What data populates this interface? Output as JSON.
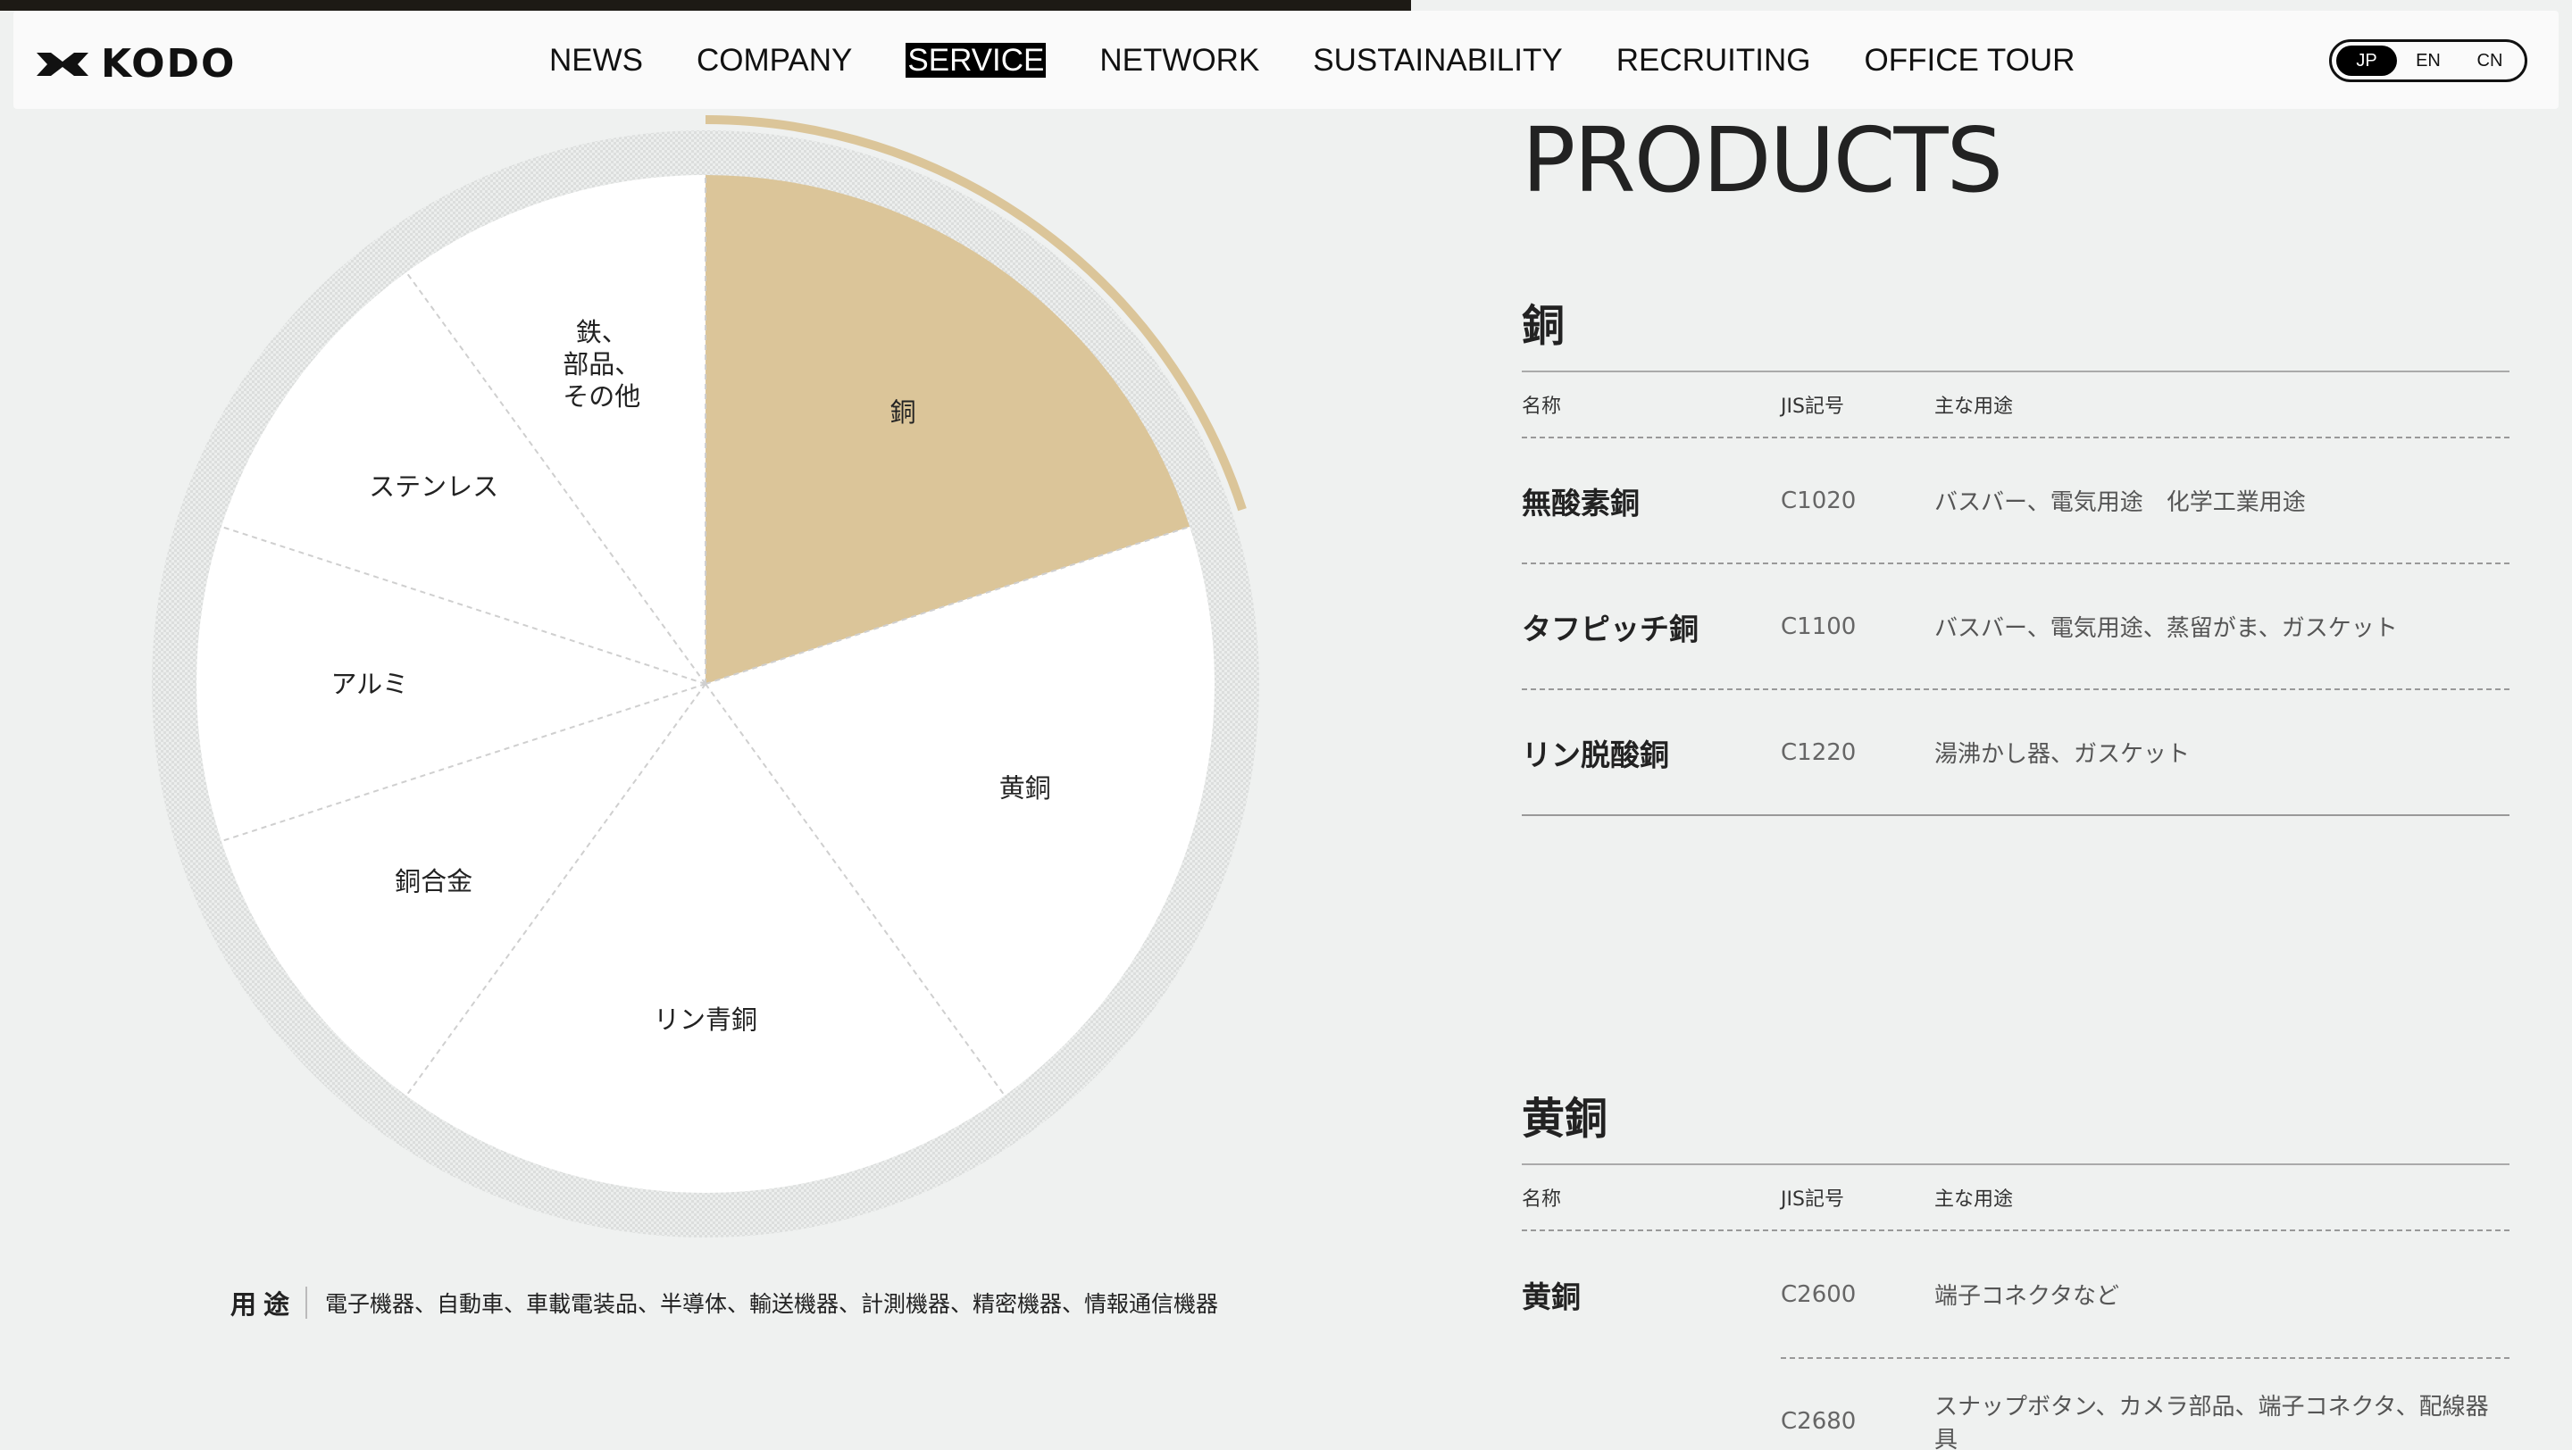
{
  "header": {
    "logo_text": "KODO",
    "nav": [
      "NEWS",
      "COMPANY",
      "SERVICE",
      "NETWORK",
      "SUSTAINABILITY",
      "RECRUITING",
      "OFFICE TOUR"
    ],
    "active_nav": "SERVICE",
    "languages": [
      "JP",
      "EN",
      "CN"
    ],
    "active_language": "JP"
  },
  "chart_data": {
    "type": "pie",
    "slices": [
      {
        "label": "銅",
        "value": 20,
        "highlighted": true
      },
      {
        "label": "黄銅",
        "value": 20
      },
      {
        "label": "リン青銅",
        "value": 20
      },
      {
        "label": "銅合金",
        "value": 10
      },
      {
        "label": "アルミ",
        "value": 10
      },
      {
        "label": "ステンレス",
        "value": 10
      },
      {
        "label": "鉄、\n部品、\nその他",
        "value": 10
      }
    ],
    "highlight_color": "#dbc599",
    "slice_color": "#ffffff"
  },
  "usage": {
    "label": "用途",
    "text": "電子機器、自動車、車載電装品、半導体、輸送機器、計測機器、精密機器、情報通信機器"
  },
  "products": {
    "title": "PRODUCTS",
    "categories": [
      {
        "name": "銅",
        "headers": [
          "名称",
          "JIS記号",
          "主な用途"
        ],
        "rows": [
          {
            "name": "無酸素銅",
            "jis": "C1020",
            "use": "バスバー、電気用途　化学工業用途"
          },
          {
            "name": "タフピッチ銅",
            "jis": "C1100",
            "use": "バスバー、電気用途、蒸留がま、ガスケット"
          },
          {
            "name": "リン脱酸銅",
            "jis": "C1220",
            "use": "湯沸かし器、ガスケット"
          }
        ]
      },
      {
        "name": "黄銅",
        "headers": [
          "名称",
          "JIS記号",
          "主な用途"
        ],
        "rows": [
          {
            "name": "黄銅",
            "jis": "C2600",
            "use": "端子コネクタなど"
          },
          {
            "name": "",
            "jis": "C2680",
            "use": "スナップボタン、カメラ部品、端子コネクタ、配線器具"
          }
        ]
      }
    ]
  }
}
